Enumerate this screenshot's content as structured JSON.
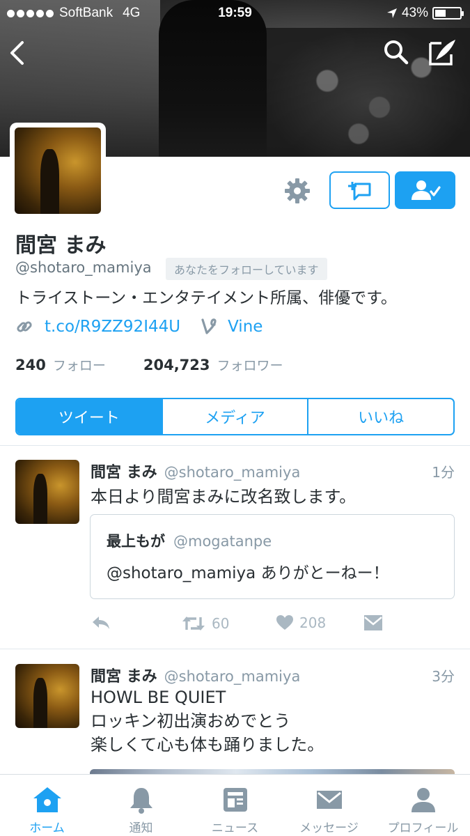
{
  "status_bar": {
    "carrier": "SoftBank",
    "network": "4G",
    "time": "19:59",
    "battery": "43%",
    "battery_level": 0.43
  },
  "profile": {
    "name": "間宮 まみ",
    "handle": "@shotaro_mamiya",
    "follows_you_badge": "あなたをフォローしています",
    "bio": "トライストーン・エンタテイメント所属、俳優です。",
    "link": "t.co/R9ZZ92I44U",
    "vine_label": "Vine",
    "following_count": "240",
    "following_label": "フォロー",
    "followers_count": "204,723",
    "followers_label": "フォロワー"
  },
  "segments": [
    {
      "label": "ツイート",
      "active": true
    },
    {
      "label": "メディア",
      "active": false
    },
    {
      "label": "いいね",
      "active": false
    }
  ],
  "tweets": [
    {
      "name": "間宮 まみ",
      "handle": "@shotaro_mamiya",
      "time": "1分",
      "text": "本日より間宮まみに改名致します。",
      "quote": {
        "name": "最上もが",
        "handle": "@mogatanpe",
        "text": "@shotaro_mamiya ありがとーねー！"
      },
      "retweets": "60",
      "likes": "208"
    },
    {
      "name": "間宮 まみ",
      "handle": "@shotaro_mamiya",
      "time": "3分",
      "lines": [
        "HOWL BE QUIET",
        "ロッキン初出演おめでとう",
        "楽しくて心も体も踊りました。"
      ]
    }
  ],
  "tabbar": [
    {
      "label": "ホーム",
      "icon": "home-icon",
      "active": true
    },
    {
      "label": "通知",
      "icon": "bell-icon",
      "active": false
    },
    {
      "label": "ニュース",
      "icon": "news-icon",
      "active": false
    },
    {
      "label": "メッセージ",
      "icon": "envelope-icon",
      "active": false
    },
    {
      "label": "プロフィール",
      "icon": "person-icon",
      "active": false
    }
  ],
  "colors": {
    "accent": "#1da1f2",
    "text": "#292f33",
    "muted": "#8899a6"
  }
}
